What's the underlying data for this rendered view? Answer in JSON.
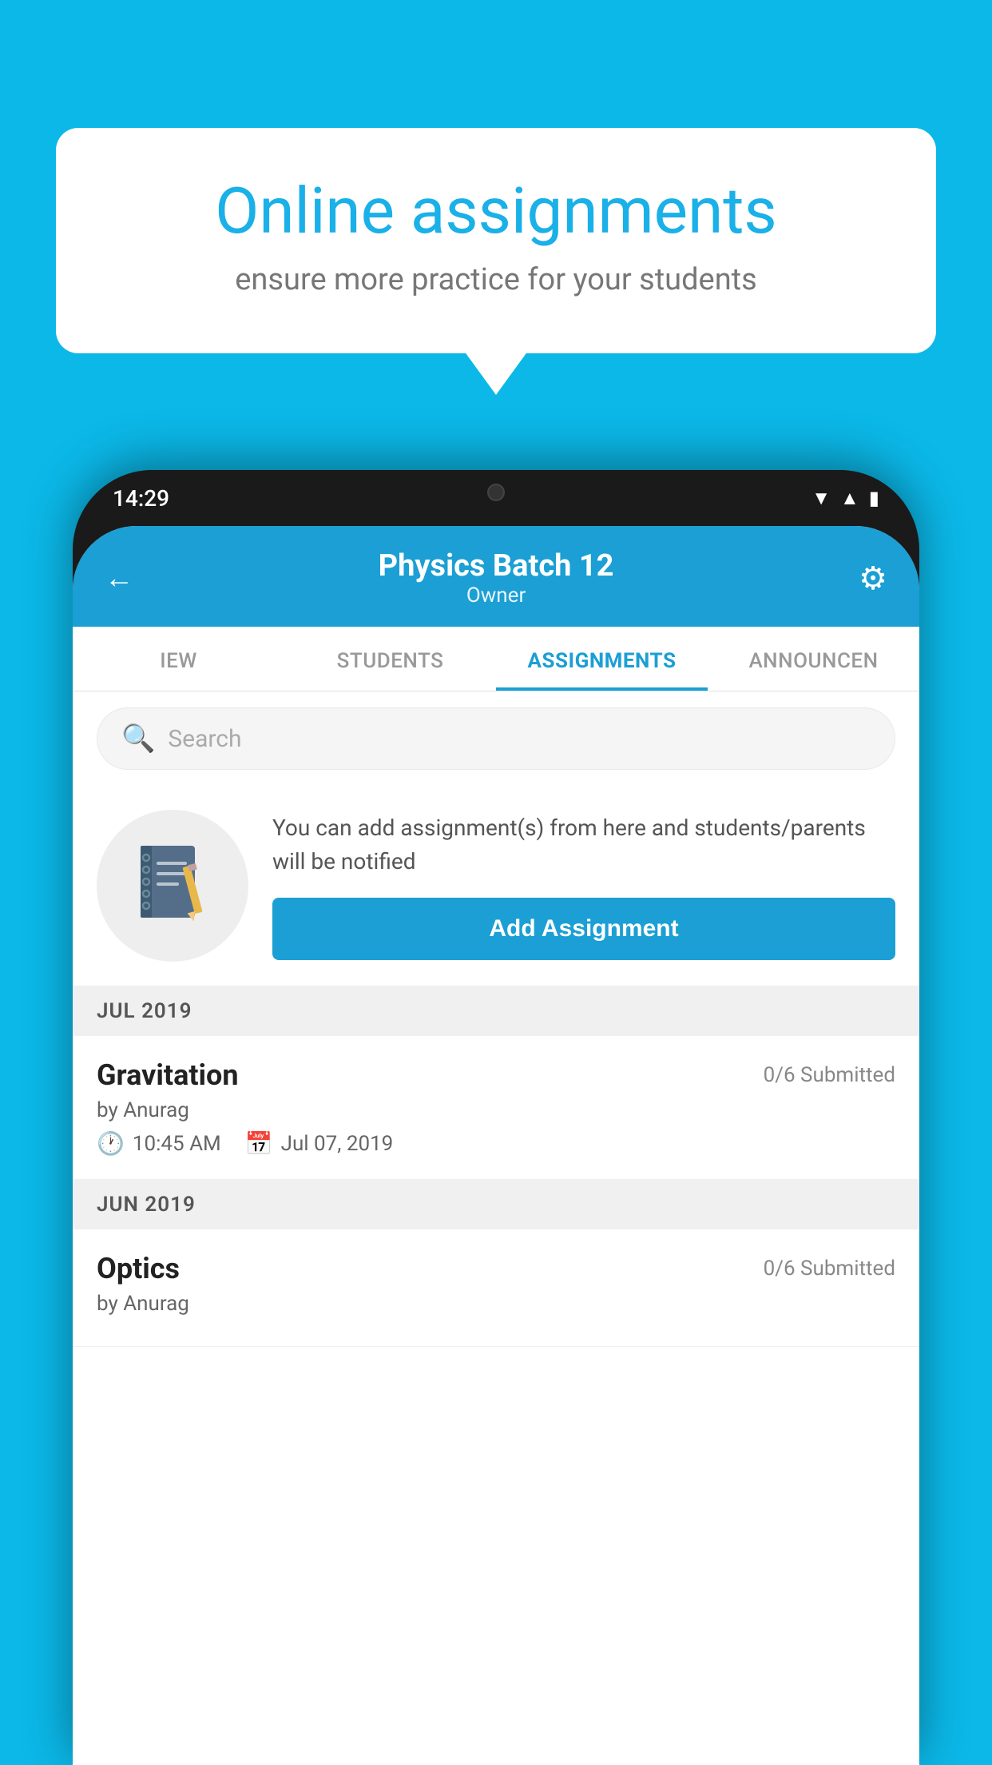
{
  "background_color": "#0bb8e8",
  "speech_bubble": {
    "title": "Online assignments",
    "subtitle": "ensure more practice for your students"
  },
  "phone": {
    "time": "14:29",
    "header": {
      "title": "Physics Batch 12",
      "subtitle": "Owner",
      "back_label": "←",
      "gear_label": "⚙"
    },
    "tabs": [
      {
        "label": "IEW",
        "active": false
      },
      {
        "label": "STUDENTS",
        "active": false
      },
      {
        "label": "ASSIGNMENTS",
        "active": true
      },
      {
        "label": "ANNOUNCEN",
        "active": false
      }
    ],
    "search": {
      "placeholder": "Search"
    },
    "add_assignment": {
      "description": "You can add assignment(s) from here and students/parents will be notified",
      "button_label": "Add Assignment"
    },
    "sections": [
      {
        "label": "JUL 2019",
        "items": [
          {
            "title": "Gravitation",
            "submitted": "0/6 Submitted",
            "author": "by Anurag",
            "time": "10:45 AM",
            "date": "Jul 07, 2019"
          }
        ]
      },
      {
        "label": "JUN 2019",
        "items": [
          {
            "title": "Optics",
            "submitted": "0/6 Submitted",
            "author": "by Anurag",
            "time": "",
            "date": ""
          }
        ]
      }
    ]
  }
}
